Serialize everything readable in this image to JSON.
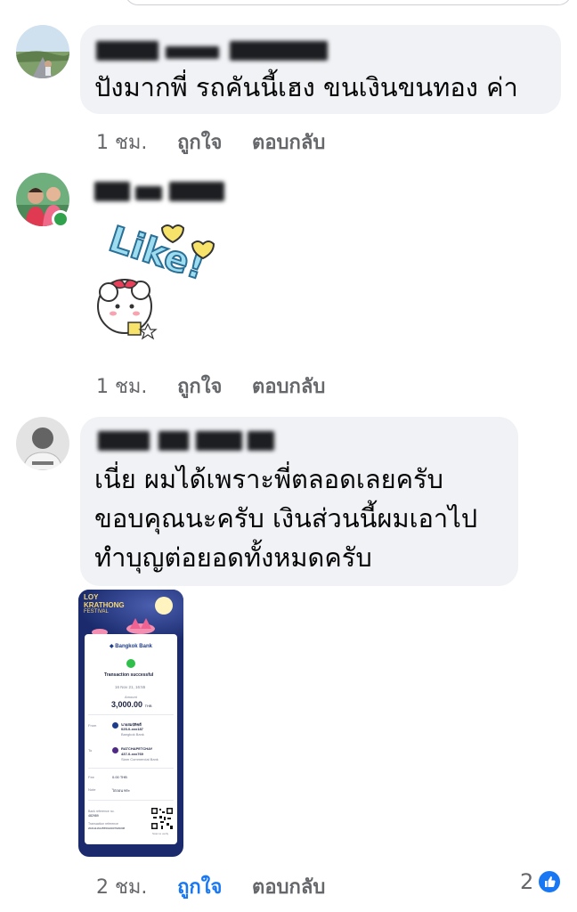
{
  "comments": [
    {
      "text": "ปังมากพี่ รถคันนี้เฮง ขนเงินขนทอง ค่า",
      "time": "1 ชม.",
      "like_label": "ถูกใจ",
      "reply_label": "ตอบกลับ"
    },
    {
      "sticker": "Like!",
      "time": "1 ชม.",
      "like_label": "ถูกใจ",
      "reply_label": "ตอบกลับ"
    },
    {
      "text_lines": [
        "เนี่ย ผมได้เพราะพี่ตลอดเลยครับ",
        "ขอบคุณนะครับ เงินส่วนนี้ผมเอาไป",
        "ทำบุญต่อยอดทั้งหมดครับ"
      ],
      "time": "2 ชม.",
      "like_label": "ถูกใจ",
      "reply_label": "ตอบกลับ",
      "reaction_count": "2"
    }
  ],
  "receipt": {
    "banner_line1": "LOY",
    "banner_line2": "KRATHONG",
    "banner_line3": "FESTIVAL",
    "bank": "Bangkok Bank",
    "status": "Transaction successful",
    "datetime": "16 Nov 21, 16:55",
    "amount_label": "Amount",
    "amount": "3,000.00",
    "currency": "THB",
    "from_label": "From",
    "from_name": "นายสมบัติชดี",
    "from_account": "025-0-xxx187",
    "from_bank": "Bangkok Bank",
    "to_label": "To",
    "to_name": "RATCHAPETCHAY",
    "to_account": "437-0-xxx769",
    "to_bank": "Siam Commercial Bank",
    "fee_label": "Fee",
    "fee": "0.00 THB",
    "note_label": "Note",
    "note": "ไถ่ถอน พระ",
    "ref_label": "Bank reference no.",
    "ref": "482989",
    "txn_ref_label": "Transaction reference",
    "txn_ref": "2021111614555024007929308",
    "scan_label": "Scan to verify"
  },
  "colors": {
    "bubble": "#f0f2f5",
    "meta": "#65676b",
    "accent": "#1877f2",
    "online": "#31a24c"
  }
}
